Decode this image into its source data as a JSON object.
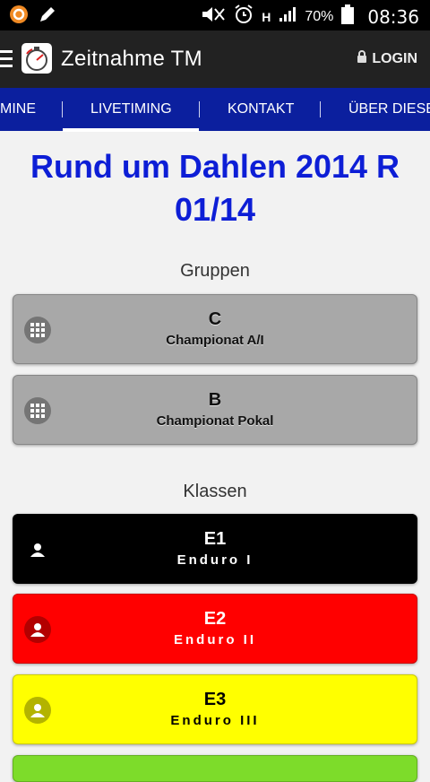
{
  "status_bar": {
    "battery_percent": "70%",
    "time": "08:36",
    "network_label": "H"
  },
  "app_bar": {
    "title": "Zeitnahme TM",
    "login_label": "LOGIN"
  },
  "nav": {
    "items": [
      "MINE",
      "LIVETIMING",
      "KONTAKT",
      "ÜBER DIESE"
    ],
    "active": "LIVETIMING"
  },
  "page": {
    "title": "Rund um Dahlen 2014 R 01/14"
  },
  "groups": {
    "heading": "Gruppen",
    "items": [
      {
        "code": "C",
        "name": "Championat A/I"
      },
      {
        "code": "B",
        "name": "Championat Pokal"
      }
    ]
  },
  "classes": {
    "heading": "Klassen",
    "items": [
      {
        "code": "E1",
        "name": "Enduro I",
        "color": "#000000"
      },
      {
        "code": "E2",
        "name": "Enduro II",
        "color": "#ff0000"
      },
      {
        "code": "E3",
        "name": "Enduro III",
        "color": "#ffff00"
      }
    ],
    "next_tile_color": "#7ddc2a"
  },
  "icons": {
    "status_left": [
      "notification-circle-icon",
      "pencil-icon"
    ],
    "status_right": [
      "mute-icon",
      "alarm-icon",
      "signal-icon",
      "battery-icon"
    ],
    "group_icon": "grid-icon",
    "class_icon": "person-icon",
    "login_icon": "lock-icon",
    "menu_icon": "hamburger-icon"
  }
}
